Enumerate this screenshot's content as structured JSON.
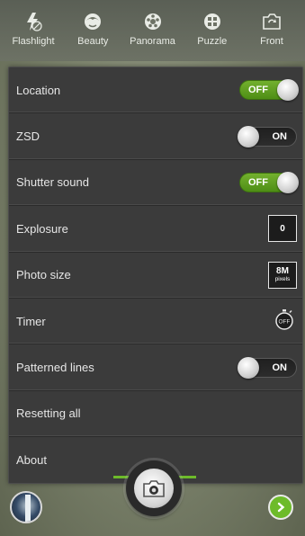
{
  "modes": [
    {
      "label": "Flashlight",
      "icon": "flashlight-off-icon"
    },
    {
      "label": "Beauty",
      "icon": "beauty-face-icon"
    },
    {
      "label": "Panorama",
      "icon": "panorama-icon"
    },
    {
      "label": "Puzzle",
      "icon": "puzzle-icon"
    },
    {
      "label": "Front",
      "icon": "front-camera-switch-icon"
    }
  ],
  "settings": {
    "location": {
      "label": "Location",
      "toggle": "OFF"
    },
    "zsd": {
      "label": "ZSD",
      "toggle": "ON"
    },
    "shutter_sound": {
      "label": "Shutter sound",
      "toggle": "OFF"
    },
    "explosure": {
      "label": "Explosure",
      "value": "0"
    },
    "photo_size": {
      "label": "Photo size",
      "value": "8M",
      "unit": "pixels"
    },
    "timer": {
      "label": "Timer",
      "value": "OFF"
    },
    "patterned_lines": {
      "label": "Patterned lines",
      "toggle": "ON"
    },
    "resetting_all": {
      "label": "Resetting all"
    },
    "about": {
      "label": "About"
    }
  },
  "colors": {
    "accent_green": "#6dbb2a",
    "panel_bg": "#3b3b3b"
  }
}
